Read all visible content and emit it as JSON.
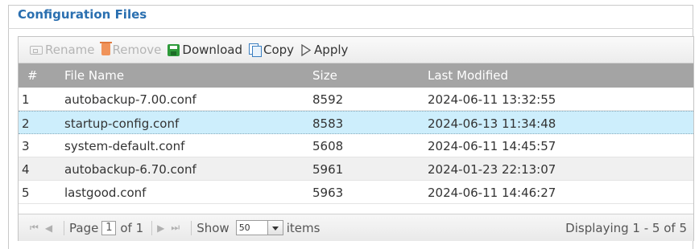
{
  "section": {
    "title": "Configuration Files"
  },
  "toolbar": {
    "rename_label": "Rename",
    "remove_label": "Remove",
    "download_label": "Download",
    "copy_label": "Copy",
    "apply_label": "Apply"
  },
  "table": {
    "headers": {
      "num": "#",
      "name": "File Name",
      "size": "Size",
      "modified": "Last Modified"
    },
    "rows": [
      {
        "num": "1",
        "name": "autobackup-7.00.conf",
        "size": "8592",
        "modified": "2024-06-11 13:32:55"
      },
      {
        "num": "2",
        "name": "startup-config.conf",
        "size": "8583",
        "modified": "2024-06-13 11:34:48"
      },
      {
        "num": "3",
        "name": "system-default.conf",
        "size": "5608",
        "modified": "2024-06-11 14:45:57"
      },
      {
        "num": "4",
        "name": "autobackup-6.70.conf",
        "size": "5961",
        "modified": "2024-01-23 22:13:07"
      },
      {
        "num": "5",
        "name": "lastgood.conf",
        "size": "5963",
        "modified": "2024-06-11 14:46:27"
      }
    ],
    "selected_row": 2
  },
  "pager": {
    "page_label": "Page",
    "page_value": "1",
    "of_label": "of 1",
    "show_label": "Show",
    "show_value": "50",
    "items_label": "items",
    "displaying": "Displaying 1 - 5 of 5"
  },
  "colors": {
    "title": "#2a6fb0",
    "header_bg": "#a4a4a4",
    "selected_row": "#cdeefc",
    "download_icon": "#2e9a3a",
    "remove_icon": "#f0935a"
  }
}
